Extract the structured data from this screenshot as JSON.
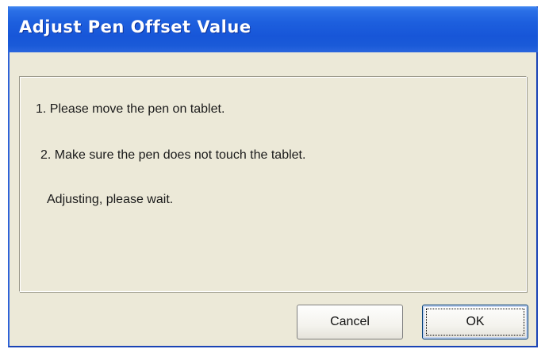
{
  "window": {
    "title": "Adjust Pen Offset Value"
  },
  "content": {
    "line1": "1. Please move the pen on tablet.",
    "line2": "2. Make sure the pen does not touch the tablet.",
    "line3": "Adjusting, please wait."
  },
  "buttons": {
    "cancel_label": "Cancel",
    "ok_label": "OK"
  },
  "colors": {
    "titlebar": "#1d5fde",
    "dialog_background": "#ece9d8"
  }
}
